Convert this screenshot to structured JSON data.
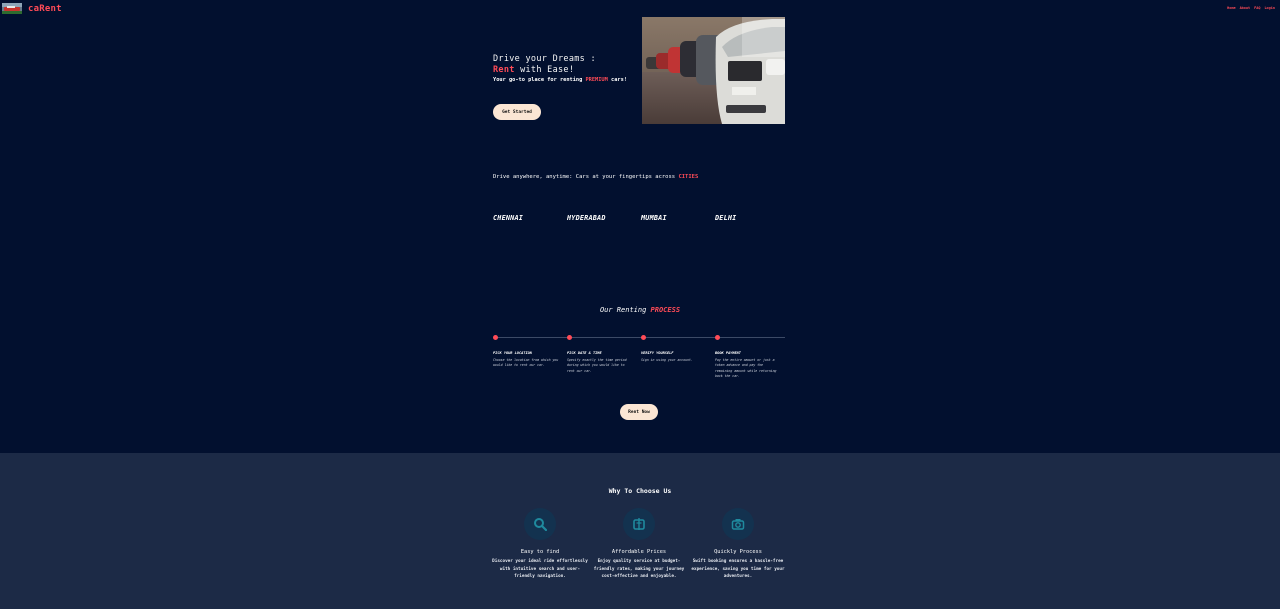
{
  "header": {
    "brand": "caRent",
    "logo_icon": "car-logo-icon",
    "nav": [
      "Home",
      "About",
      "FAQ",
      "Login"
    ]
  },
  "hero": {
    "title_line1": "Drive your Dreams :",
    "title_rent": "Rent",
    "title_line2_rest": " with Ease!",
    "subtitle_before": "Your go-to place for renting ",
    "subtitle_highlight": "PREMIUM",
    "subtitle_after": " cars!",
    "cta": "Get Started",
    "photo_icon": "parked-cars-photo"
  },
  "cities": {
    "intro_before": "Drive anywhere, anytime: Cars at your fingertips across ",
    "intro_highlight": "CITIES",
    "items": [
      "CHENNAI",
      "HYDERABAD",
      "MUMBAI",
      "DELHI"
    ]
  },
  "process": {
    "title_before": "Our Renting ",
    "title_highlight": "PROCESS",
    "steps": [
      {
        "title": "PICK YOUR LOCATION",
        "text": "Choose the location from which you would like to rent our car."
      },
      {
        "title": "PICK DATE & TIME",
        "text": "Specify exactly the time period during which you would like to rent our car."
      },
      {
        "title": "VERIFY YOURSELF",
        "text": "Sign in using your account."
      },
      {
        "title": "BOOK PAYMENT",
        "text": "Pay the entire amount or just a token advance and pay the remaining amount while returning back the car."
      }
    ],
    "cta": "Rent Now"
  },
  "why": {
    "title": "Why To Choose Us",
    "features": [
      {
        "icon": "search-icon",
        "title": "Easy to find",
        "text": "Discover your ideal ride effortlessly with intuitive search and user-friendly navigation."
      },
      {
        "icon": "money-icon",
        "title": "Affordable Prices",
        "text": "Enjoy quality service at budget-friendly rates, making your journey cost-effective and enjoyable."
      },
      {
        "icon": "camera-icon",
        "title": "Quickly Process",
        "text": "Swift booking ensures a hassle-free experience, saving you time for your adventures."
      }
    ]
  },
  "colors": {
    "background": "#02102f",
    "section_alt": "#1c2a46",
    "accent": "#ff4b57",
    "button": "#fbe6d4"
  }
}
